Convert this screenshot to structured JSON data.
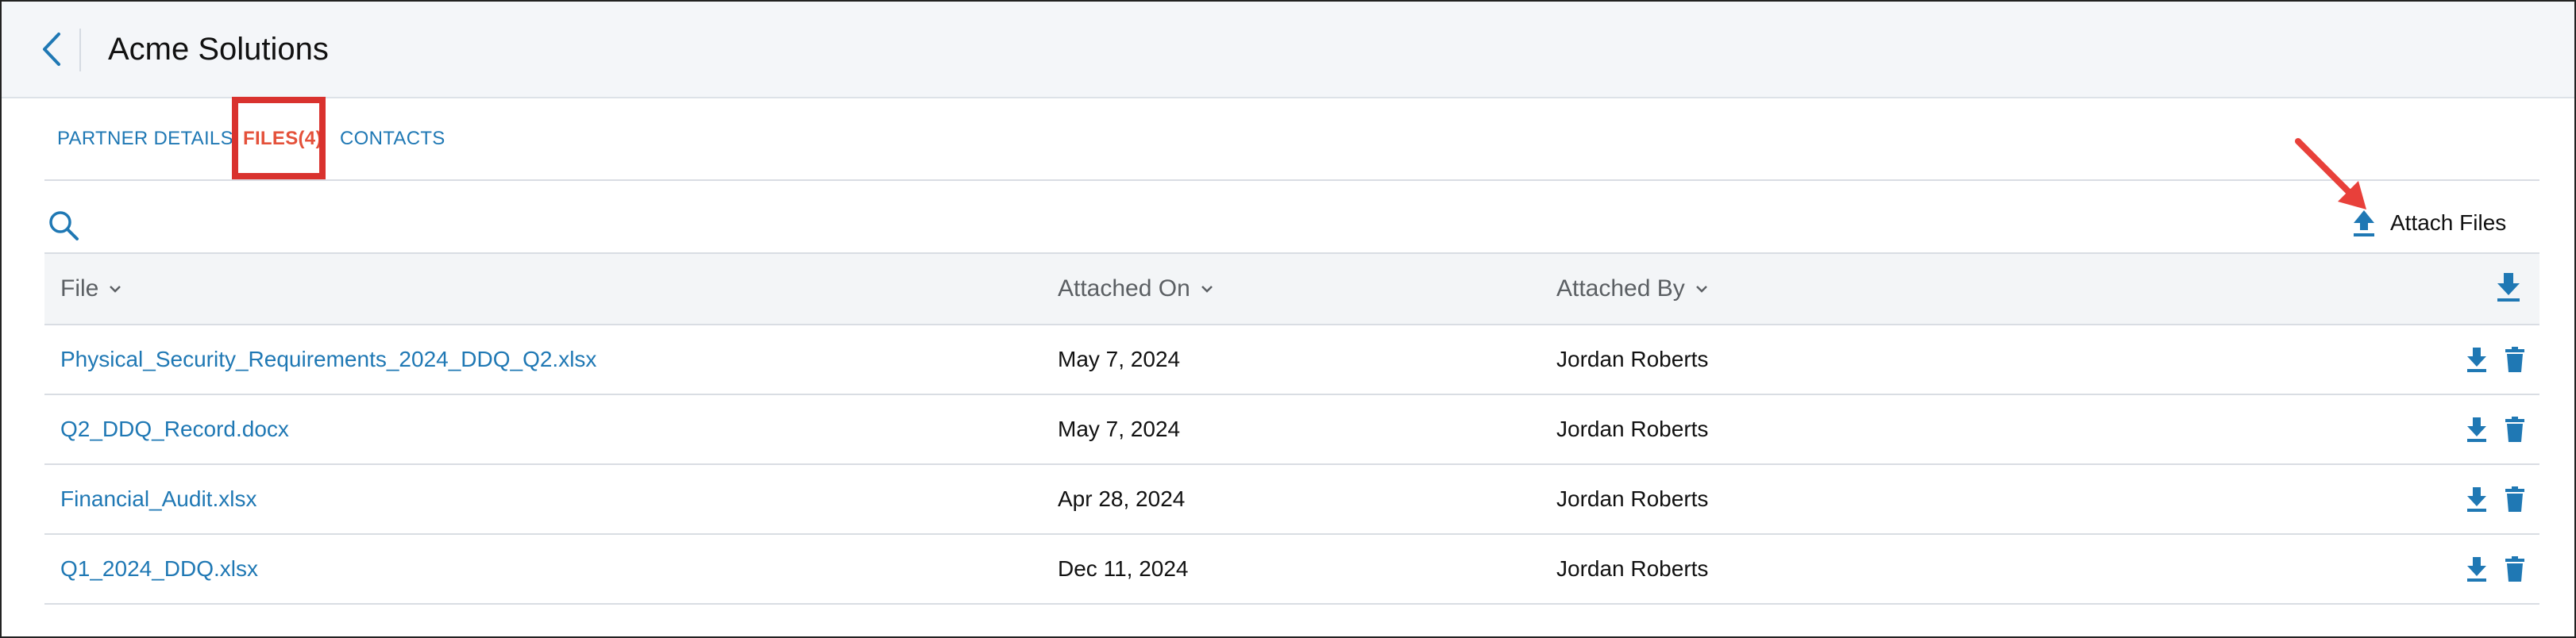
{
  "header": {
    "title": "Acme Solutions"
  },
  "tabs": [
    {
      "label": "PARTNER DETAILS",
      "active": false
    },
    {
      "label": "FILES(4)",
      "active": true
    },
    {
      "label": "CONTACTS",
      "active": false
    }
  ],
  "toolbar": {
    "attach_label": "Attach Files"
  },
  "table": {
    "columns": [
      "File",
      "Attached On",
      "Attached By"
    ],
    "rows": [
      {
        "file": "Physical_Security_Requirements_2024_DDQ_Q2.xlsx",
        "attached_on": "May 7, 2024",
        "attached_by": "Jordan Roberts"
      },
      {
        "file": "Q2_DDQ_Record.docx",
        "attached_on": "May 7, 2024",
        "attached_by": "Jordan Roberts"
      },
      {
        "file": "Financial_Audit.xlsx",
        "attached_on": "Apr 28, 2024",
        "attached_by": "Jordan Roberts"
      },
      {
        "file": "Q1_2024_DDQ.xlsx",
        "attached_on": "Dec 11, 2024",
        "attached_by": "Jordan Roberts"
      }
    ]
  },
  "colors": {
    "accent": "#1f78b4",
    "active_tab": "#e4513a",
    "annotation": "#d9322e"
  },
  "icons": [
    "back-chevron-icon",
    "search-icon",
    "upload-icon",
    "download-icon",
    "trash-icon",
    "chevron-down-icon"
  ]
}
